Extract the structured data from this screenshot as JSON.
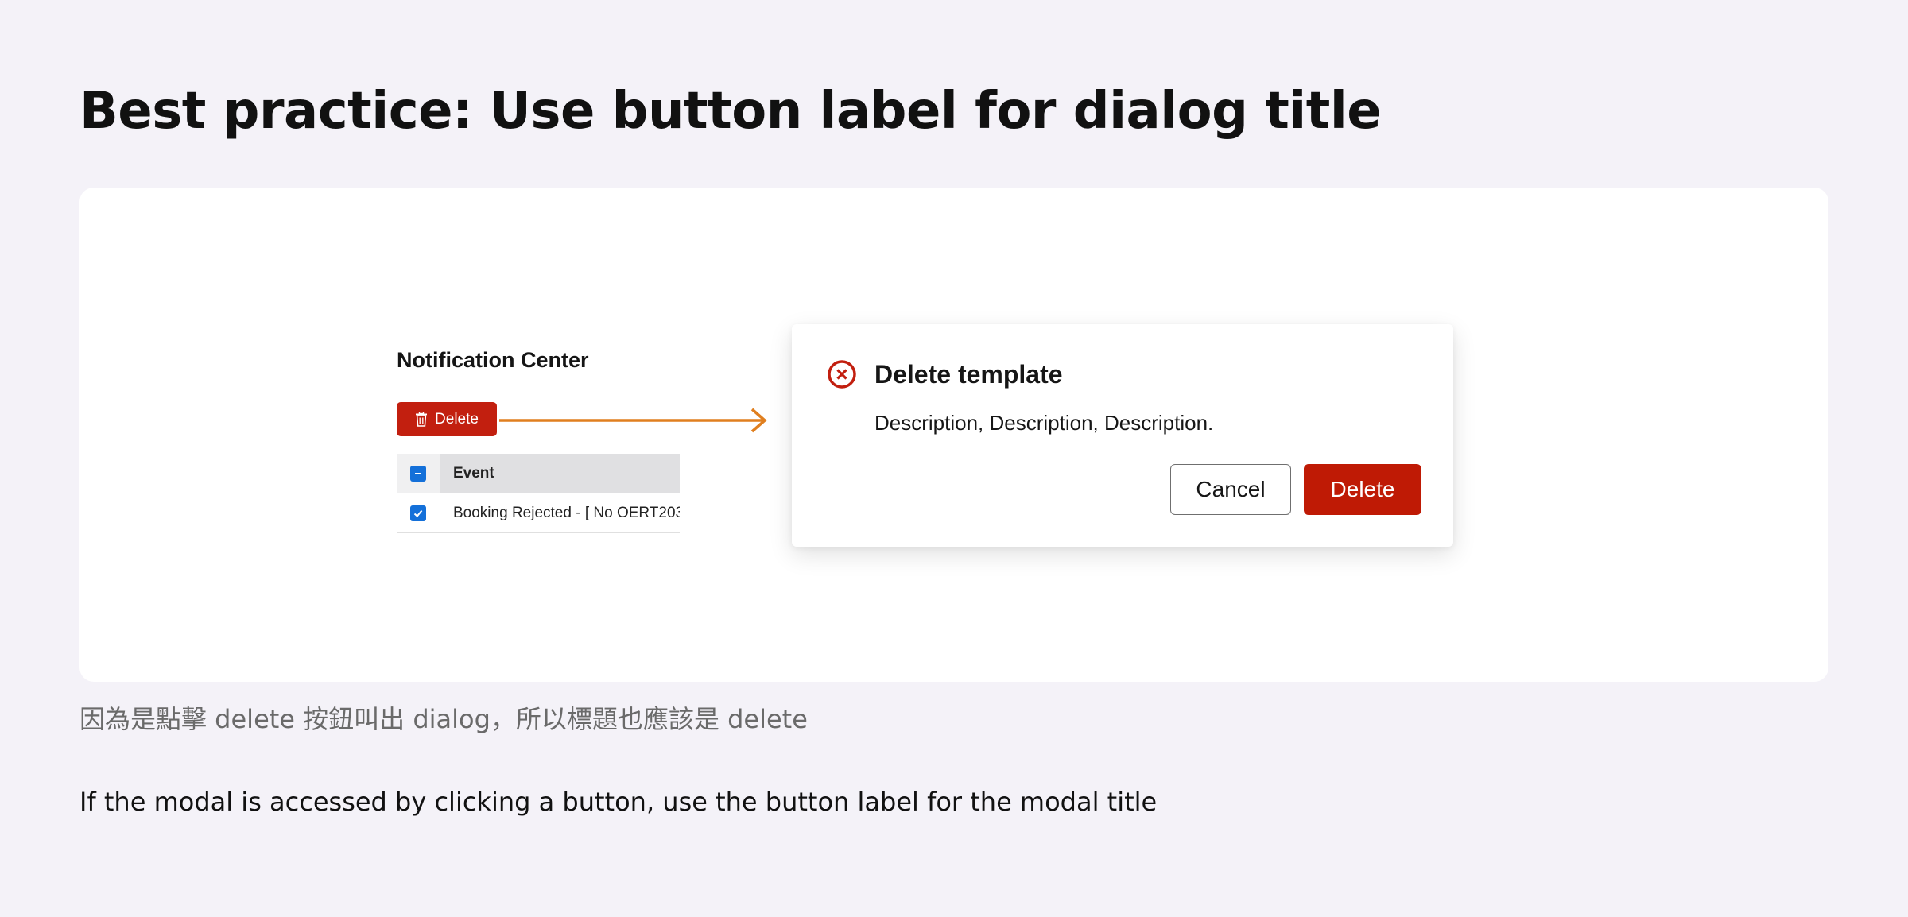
{
  "page": {
    "title": "Best practice: Use button label for dialog title",
    "caption_zh": "因為是點擊 delete 按鈕叫出 dialog，所以標題也應該是 delete",
    "caption_en": "If the modal is accessed by clicking a button, use the button label for the modal title"
  },
  "notification_center": {
    "title": "Notification Center",
    "delete_button": {
      "label": "Delete",
      "icon": "trash-icon",
      "color": "#c21f0f"
    },
    "table": {
      "columns": [
        "Event"
      ],
      "rows": [
        {
          "selected": true,
          "event": "Booking Rejected - [ No OERT203"
        }
      ],
      "header_checkbox": "indeterminate"
    }
  },
  "arrow": {
    "color": "#e07f1f"
  },
  "dialog": {
    "icon": "error-circle-x-icon",
    "icon_color": "#c21f0f",
    "title": "Delete template",
    "description": "Description, Description, Description.",
    "cancel_label": "Cancel",
    "confirm_label": "Delete",
    "confirm_color": "#bf1a05"
  }
}
